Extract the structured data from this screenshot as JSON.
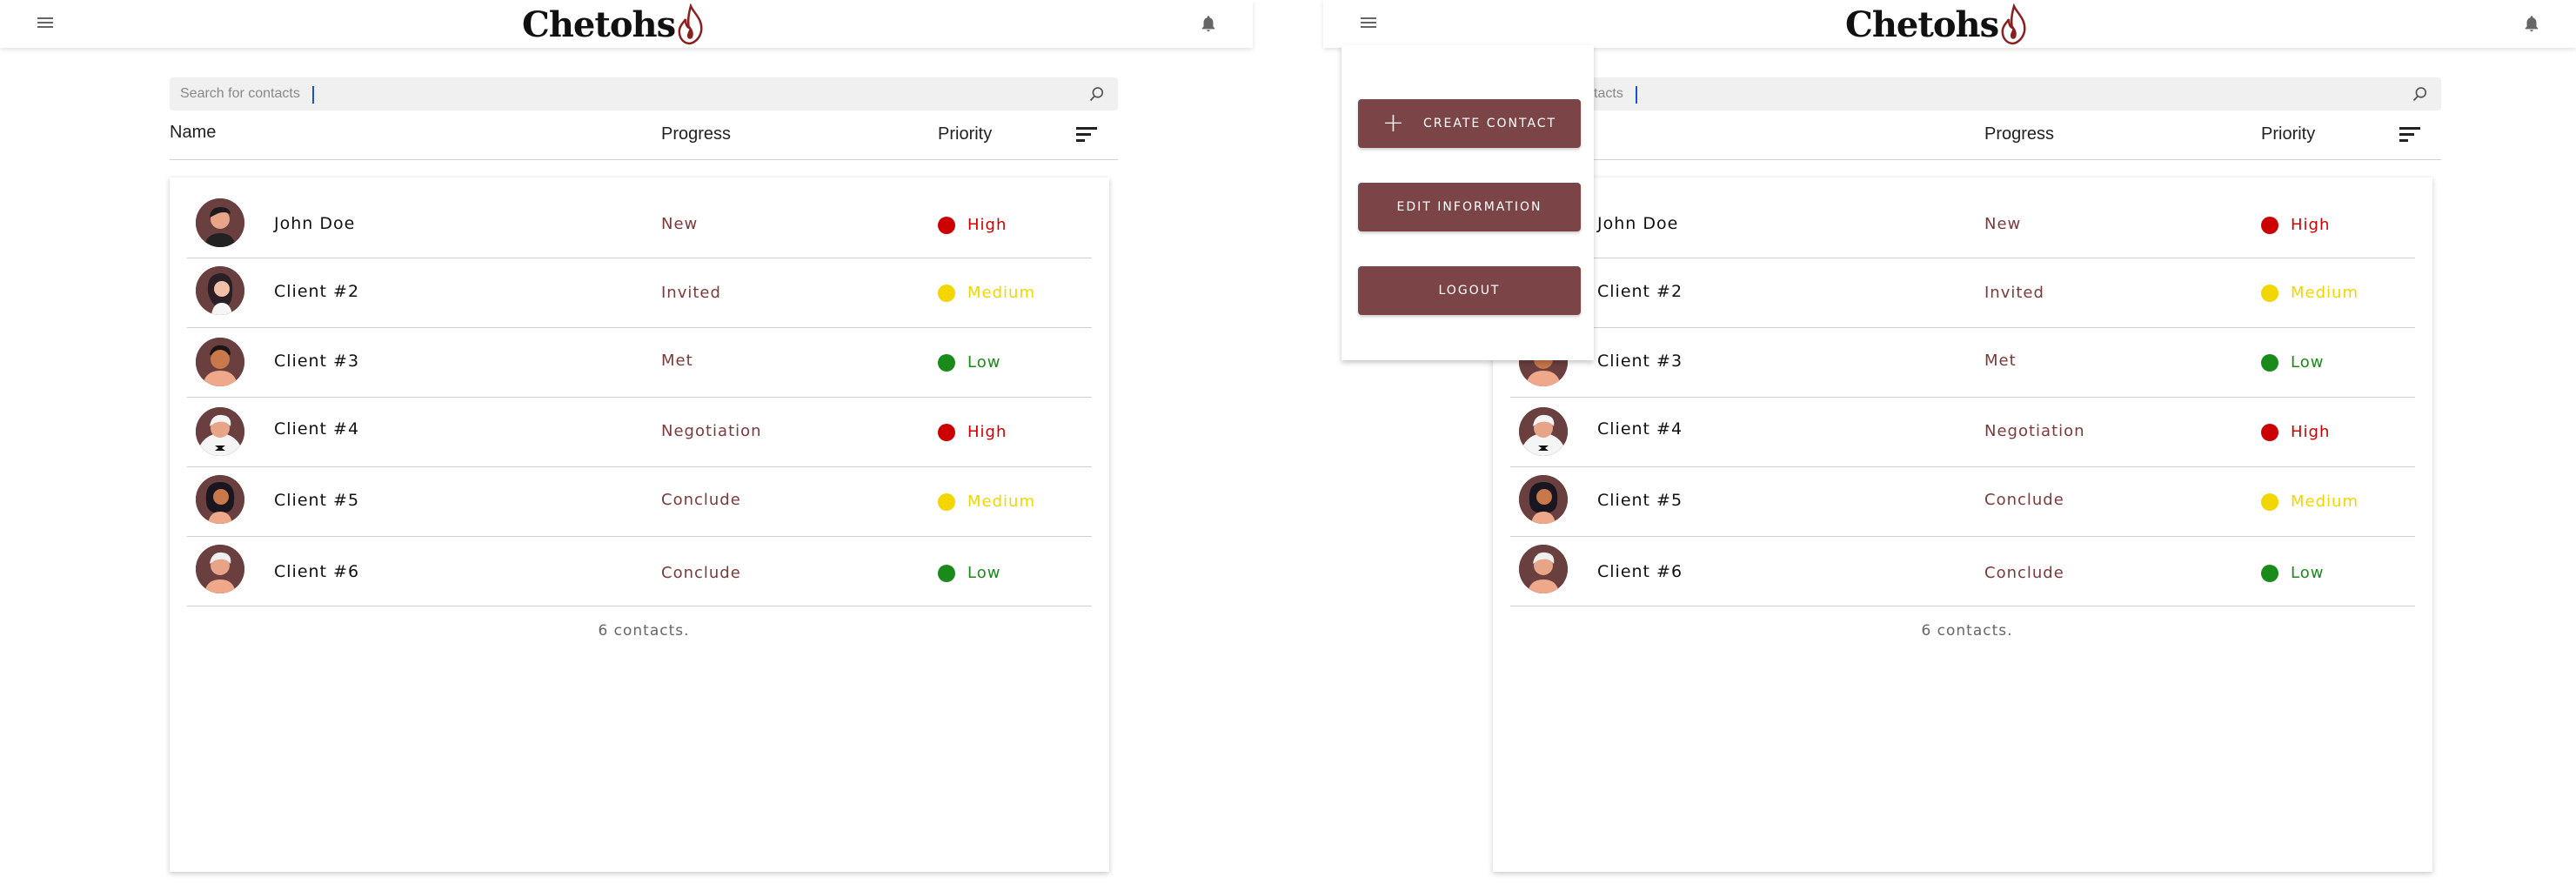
{
  "app": {
    "logo_text": "Chetohs",
    "brand_color": "#7b4547"
  },
  "search": {
    "placeholder": "Search for contacts",
    "partial_visible_text": "ntacts"
  },
  "headers": {
    "name": "Name",
    "progress": "Progress",
    "priority": "Priority"
  },
  "contacts": [
    {
      "name": "John Doe",
      "progress": "New",
      "priority": "High",
      "priority_color": "#cc0000",
      "avatar": "man-dark-hair"
    },
    {
      "name": "Client #2",
      "progress": "Invited",
      "priority": "Medium",
      "priority_color": "#f2d600",
      "avatar": "woman-dark-hair"
    },
    {
      "name": "Client #3",
      "progress": "Met",
      "priority": "Low",
      "priority_color": "#1a8a1a",
      "avatar": "man-black-hair"
    },
    {
      "name": "Client #4",
      "progress": "Negotiation",
      "priority": "High",
      "priority_color": "#cc0000",
      "avatar": "man-white-hair-bowtie"
    },
    {
      "name": "Client #5",
      "progress": "Conclude",
      "priority": "Medium",
      "priority_color": "#f2d600",
      "avatar": "woman-curly-hair"
    },
    {
      "name": "Client #6",
      "progress": "Conclude",
      "priority": "Low",
      "priority_color": "#1a8a1a",
      "avatar": "man-white-hair"
    }
  ],
  "footer": {
    "count_text": "6 contacts."
  },
  "menu": {
    "create_contact": "CREATE CONTACT",
    "edit_information": "EDIT INFORMATION",
    "logout": "LOGOUT"
  },
  "icons": {
    "menu": "hamburger-icon",
    "bell": "bell-icon",
    "search": "search-icon",
    "sort": "sort-icon",
    "plus": "plus-icon"
  }
}
